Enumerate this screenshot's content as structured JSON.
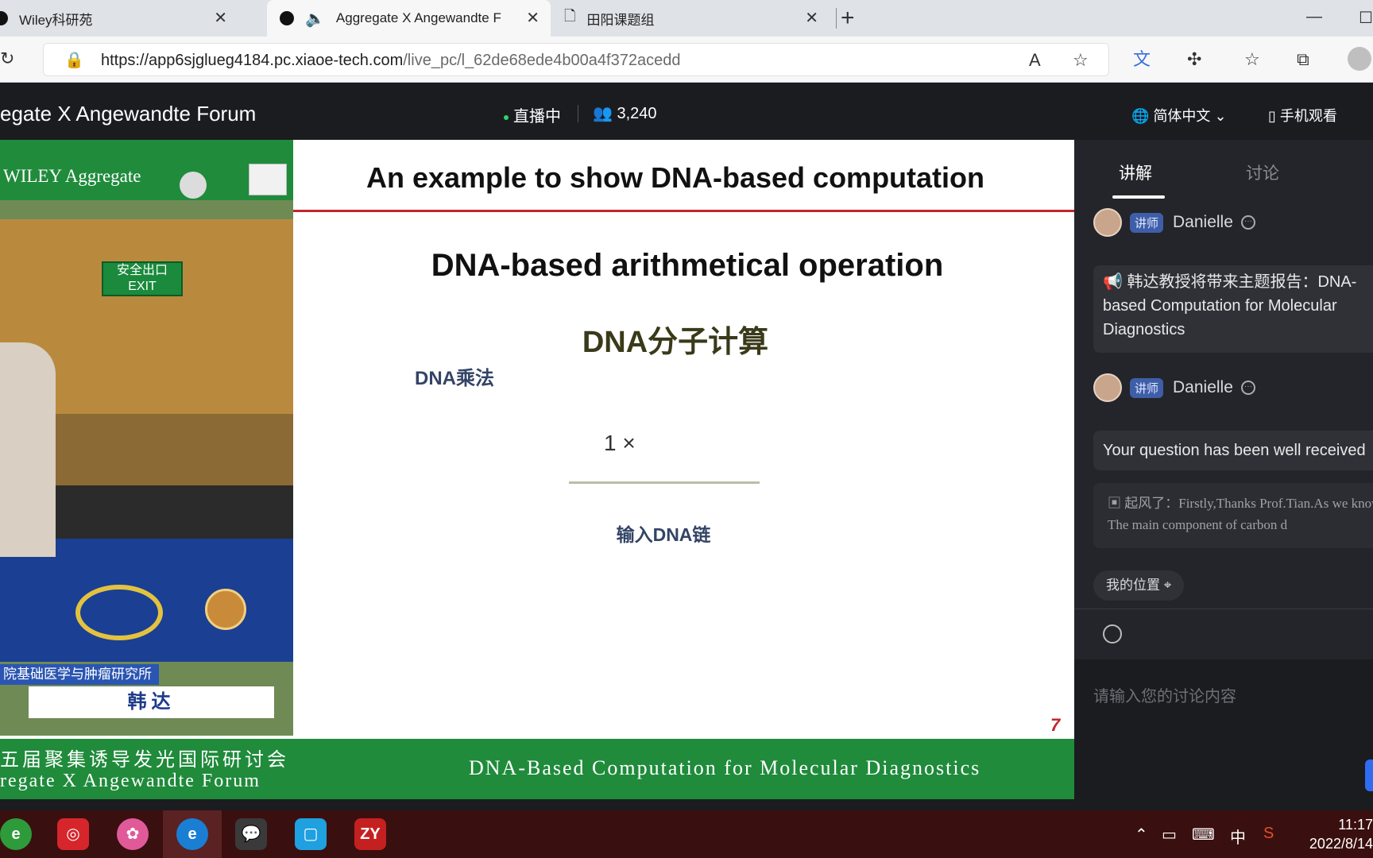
{
  "browser": {
    "tabs": [
      {
        "title": "Wiley科研苑",
        "active": false
      },
      {
        "title": "Aggregate X Angewandte F",
        "active": true
      },
      {
        "title": "田阳课题组",
        "active": false
      }
    ],
    "new_tab": "+",
    "url_host": "https://app6sjglueg4184.pc.xiaoe-tech.com",
    "url_path": "/live_pc/l_62de68ede4b00a4f372acedd"
  },
  "header": {
    "title": "egate X Angewandte Forum",
    "live_status": "直播中",
    "viewer_count": "3,240",
    "language": "简体中文",
    "mobile_watch": "手机观看"
  },
  "slide": {
    "logo_text": "WILEY Aggregate",
    "exit_sign": "安全出口\nEXIT",
    "title": "An example to show DNA-based computation",
    "heading": "DNA-based arithmetical operation",
    "heading_zh": "DNA分子计算",
    "multiply_label": "DNA乘法",
    "equation": "1 ×",
    "input_strand": "输入DNA链",
    "page_number": "7",
    "speaker_affiliation": "院基础医学与肿瘤研究所",
    "speaker_name": "韩达",
    "banner_line1": "五届聚集诱导发光国际研讨会",
    "banner_line2": "regate X Angewandte Forum",
    "banner_right": "DNA-Based Computation for Molecular Diagnostics"
  },
  "side_panel": {
    "tabs": [
      "讲解",
      "讨论"
    ],
    "messages": [
      {
        "badge": "讲师",
        "author": "Danielle",
        "text": "📢 韩达教授将带来主题报告：DNA-based Computation for Molecular Diagnostics"
      },
      {
        "badge": "讲师",
        "author": "Danielle",
        "text": "Your question has been well received",
        "quote": "起风了：Firstly,Thanks Prof.Tian.As we know now, The main component of carbon d"
      }
    ],
    "location_button": "我的位置",
    "input_placeholder": "请输入您的讨论内容"
  },
  "taskbar": {
    "ime": "中",
    "time": "11:17",
    "date": "2022/8/14"
  }
}
